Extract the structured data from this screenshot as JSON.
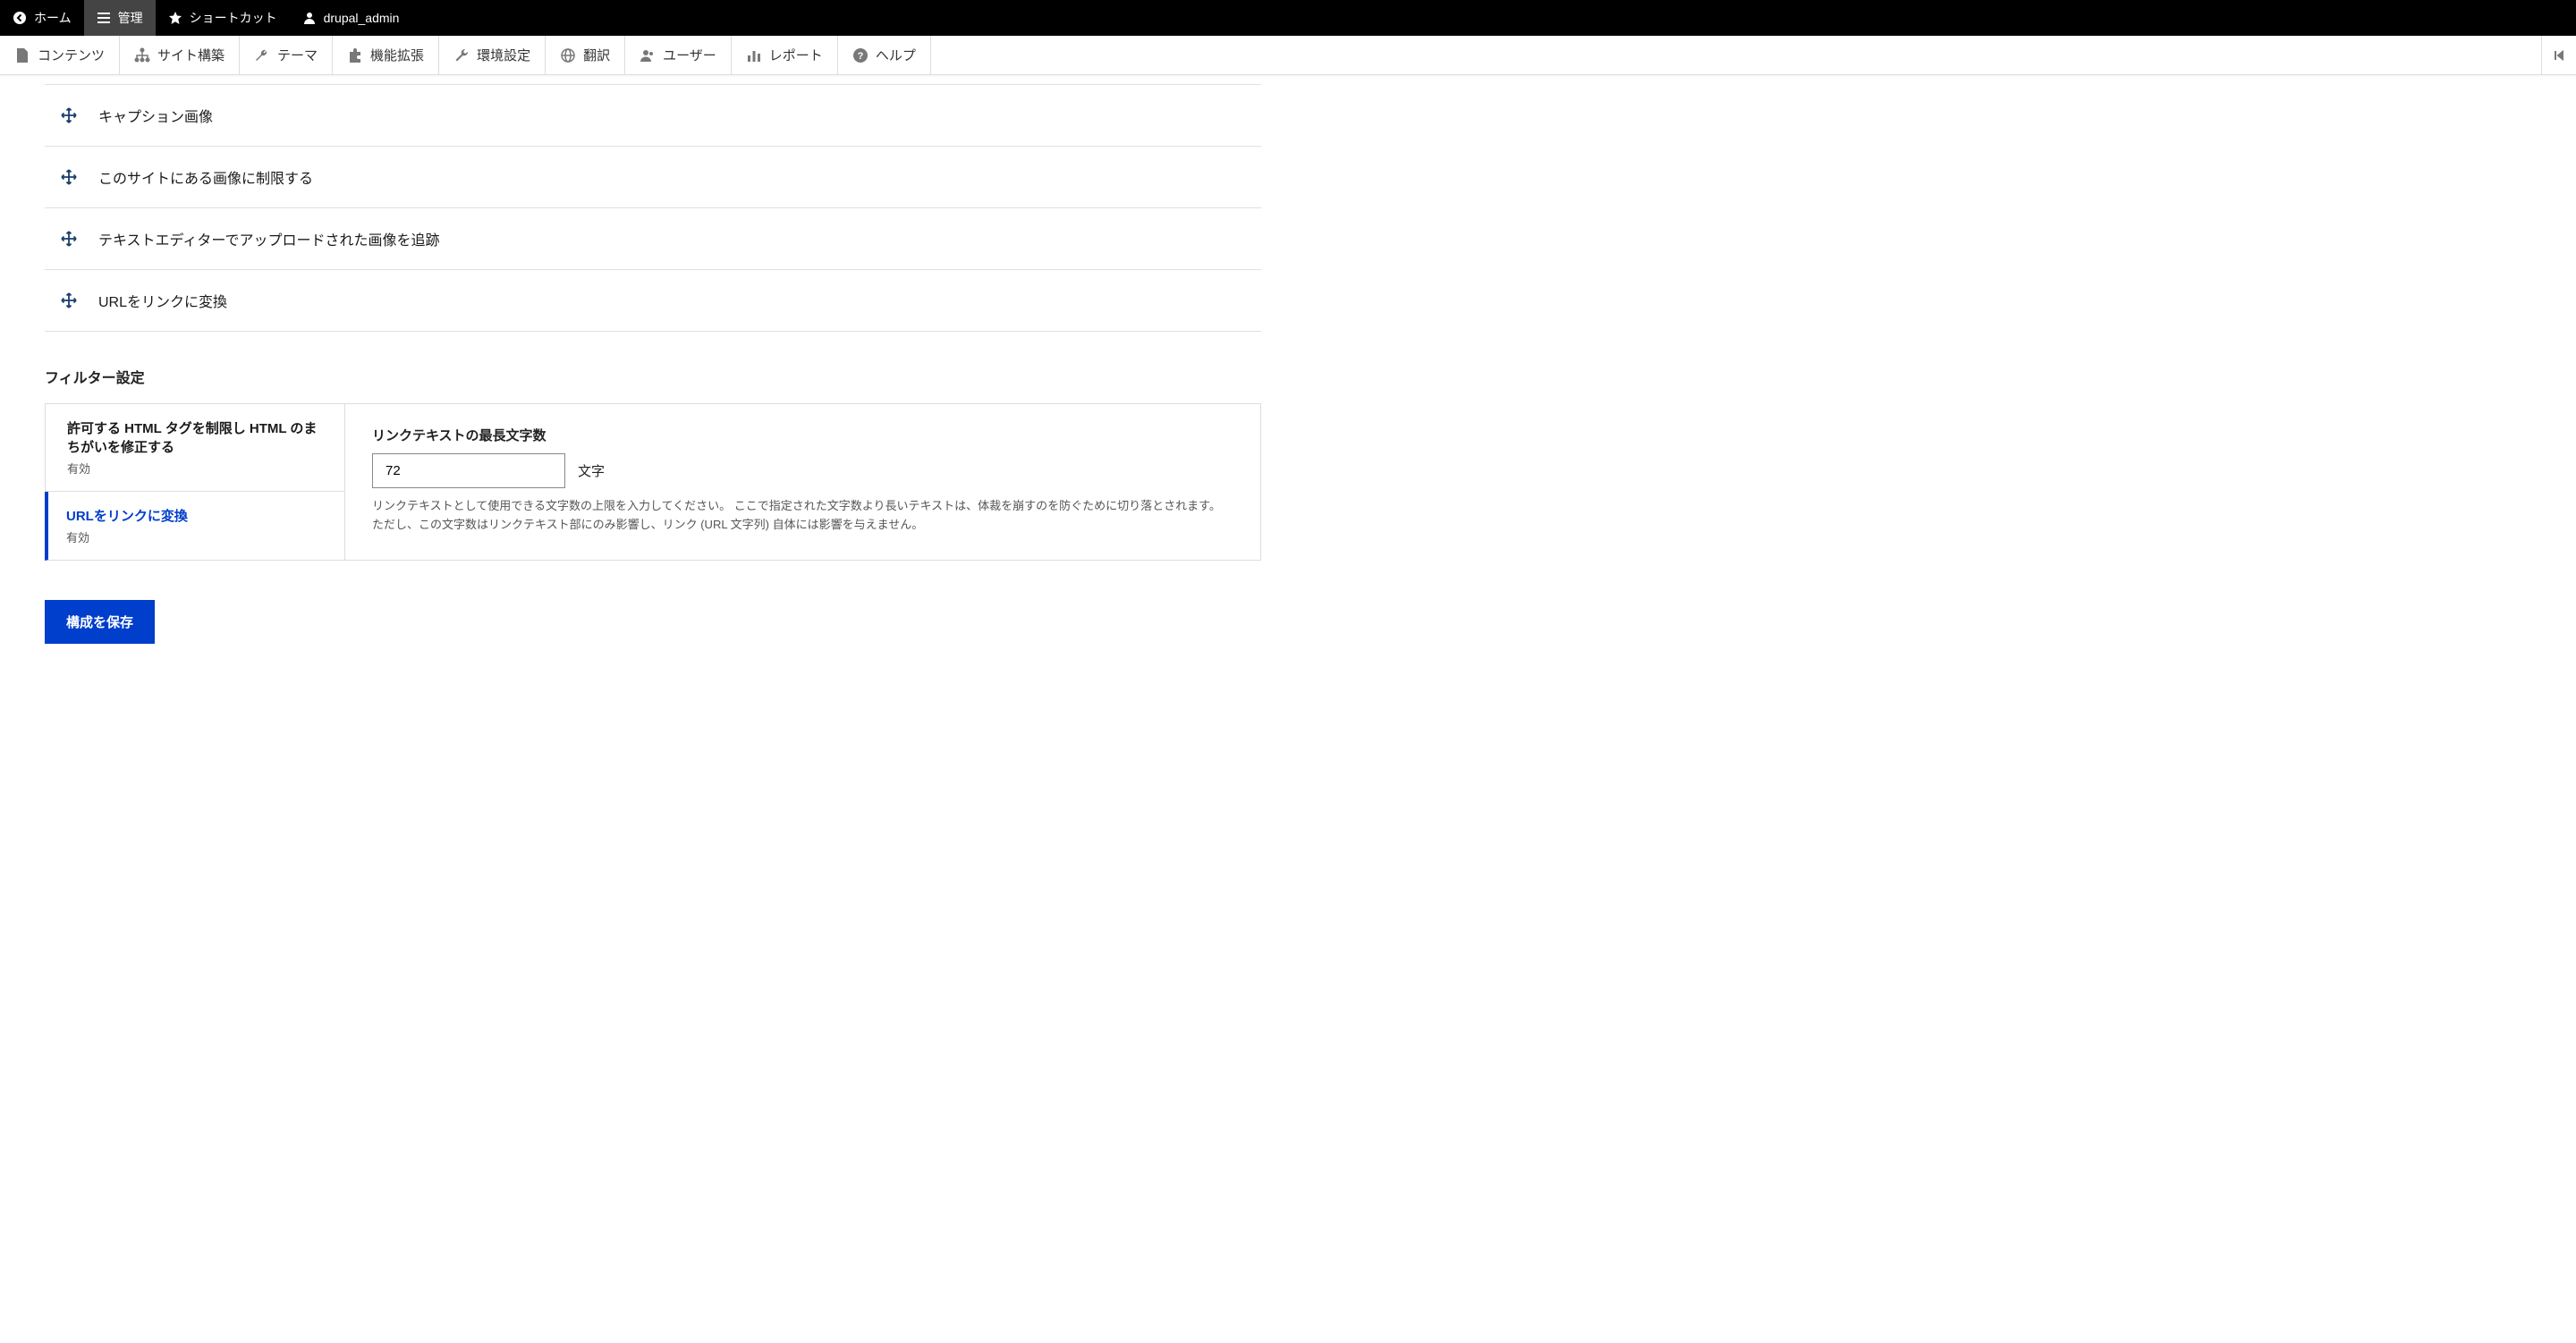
{
  "top_bar": {
    "home": "ホーム",
    "manage": "管理",
    "shortcuts": "ショートカット",
    "user": "drupal_admin"
  },
  "admin_nav": {
    "content": "コンテンツ",
    "structure": "サイト構築",
    "appearance": "テーマ",
    "extend": "機能拡張",
    "config": "環境設定",
    "translate": "翻訳",
    "people": "ユーザー",
    "reports": "レポート",
    "help": "ヘルプ"
  },
  "filters": {
    "items": [
      "キャプション画像",
      "このサイトにある画像に制限する",
      "テキストエディターでアップロードされた画像を追跡",
      "URLをリンクに変換"
    ]
  },
  "section_heading": "フィルター設定",
  "tabs": {
    "restrict_html": {
      "title": "許可する HTML タグを制限し HTML のまちがいを修正する",
      "status": "有効"
    },
    "url_to_link": {
      "title": "URLをリンクに変換",
      "status": "有効"
    }
  },
  "panel": {
    "label": "リンクテキストの最長文字数",
    "value": "72",
    "suffix": "文字",
    "desc": "リンクテキストとして使用できる文字数の上限を入力してください。 ここで指定された文字数より長いテキストは、体裁を崩すのを防ぐために切り落とされます。 ただし、この文字数はリンクテキスト部にのみ影響し、リンク (URL 文字列) 自体には影響を与えません。"
  },
  "save_button": "構成を保存"
}
